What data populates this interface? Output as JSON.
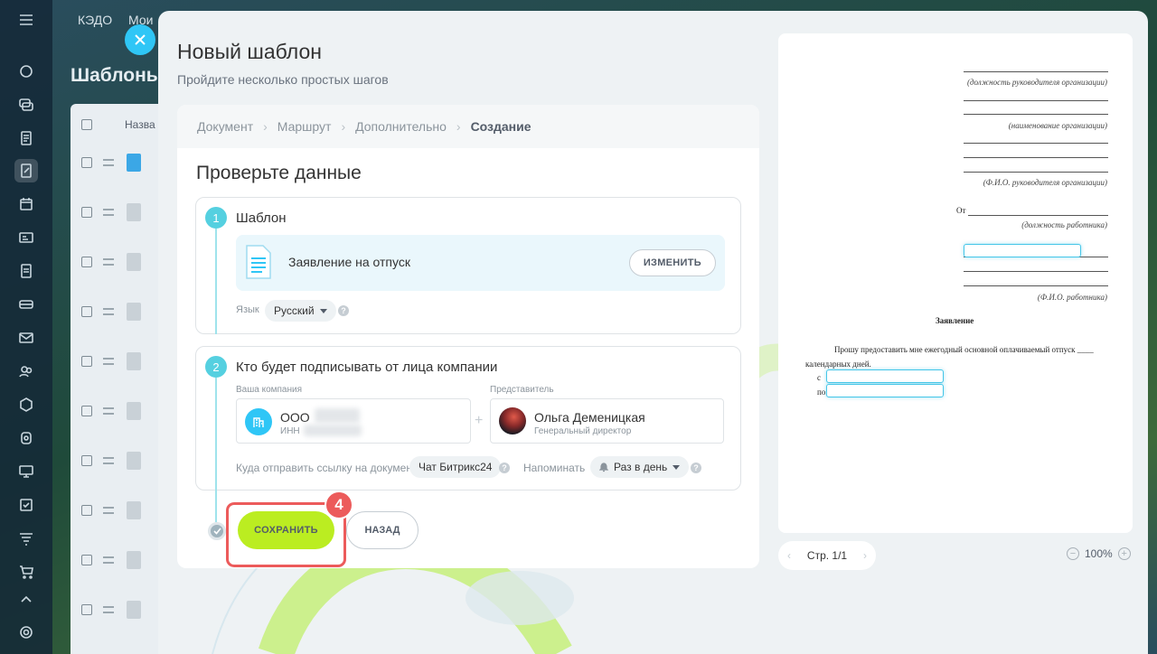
{
  "background": {
    "tabs": [
      "КЭДО",
      "Мои"
    ],
    "page_title": "Шаблоны",
    "list_header": "Назва"
  },
  "slider": {
    "title": "Новый шаблон",
    "subtitle": "Пройдите несколько простых шагов"
  },
  "steps": [
    "Документ",
    "Маршрут",
    "Дополнительно",
    "Создание"
  ],
  "check_title": "Проверьте данные",
  "section1": {
    "number": "1",
    "title": "Шаблон",
    "template_name": "Заявление на отпуск",
    "change_button": "ИЗМЕНИТЬ",
    "language_label": "Язык",
    "language_value": "Русский"
  },
  "section2": {
    "number": "2",
    "title": "Кто будет подписывать от лица компании",
    "company_label": "Ваша компания",
    "company_name": "ООО",
    "company_inn": "ИНН",
    "representative_label": "Представитель",
    "representative_name": "Ольга Деменицкая",
    "representative_role": "Генеральный директор",
    "send_link_label": "Куда отправить ссылку на документ",
    "send_link_value": "Чат Битрикс24",
    "remind_label": "Напоминать",
    "remind_value": "Раз в день"
  },
  "actions": {
    "save": "СОХРАНИТЬ",
    "back": "НАЗАД",
    "step_badge": "4"
  },
  "preview": {
    "cap_head_position": "(должность руководителя организации)",
    "cap_org_name": "(наименование организации)",
    "cap_head_name": "(Ф.И.О. руководителя организации)",
    "from": "От",
    "cap_employee_position": "(должность работника)",
    "cap_employee_name": "(Ф.И.О. работника)",
    "doc_title": "Заявление",
    "body_line1": "Прошу предоставить мне ежегодный основной оплачиваемый отпуск ____",
    "body_line2": "календарных дней.",
    "from_date": "с",
    "to_date": "по",
    "page_indicator": "Стр. 1/1",
    "zoom": "100%"
  },
  "colors": {
    "accent": "#2fc6f6",
    "save_button": "#bbed21",
    "highlight": "#ec5b5b",
    "step_number": "#55d0e0"
  }
}
